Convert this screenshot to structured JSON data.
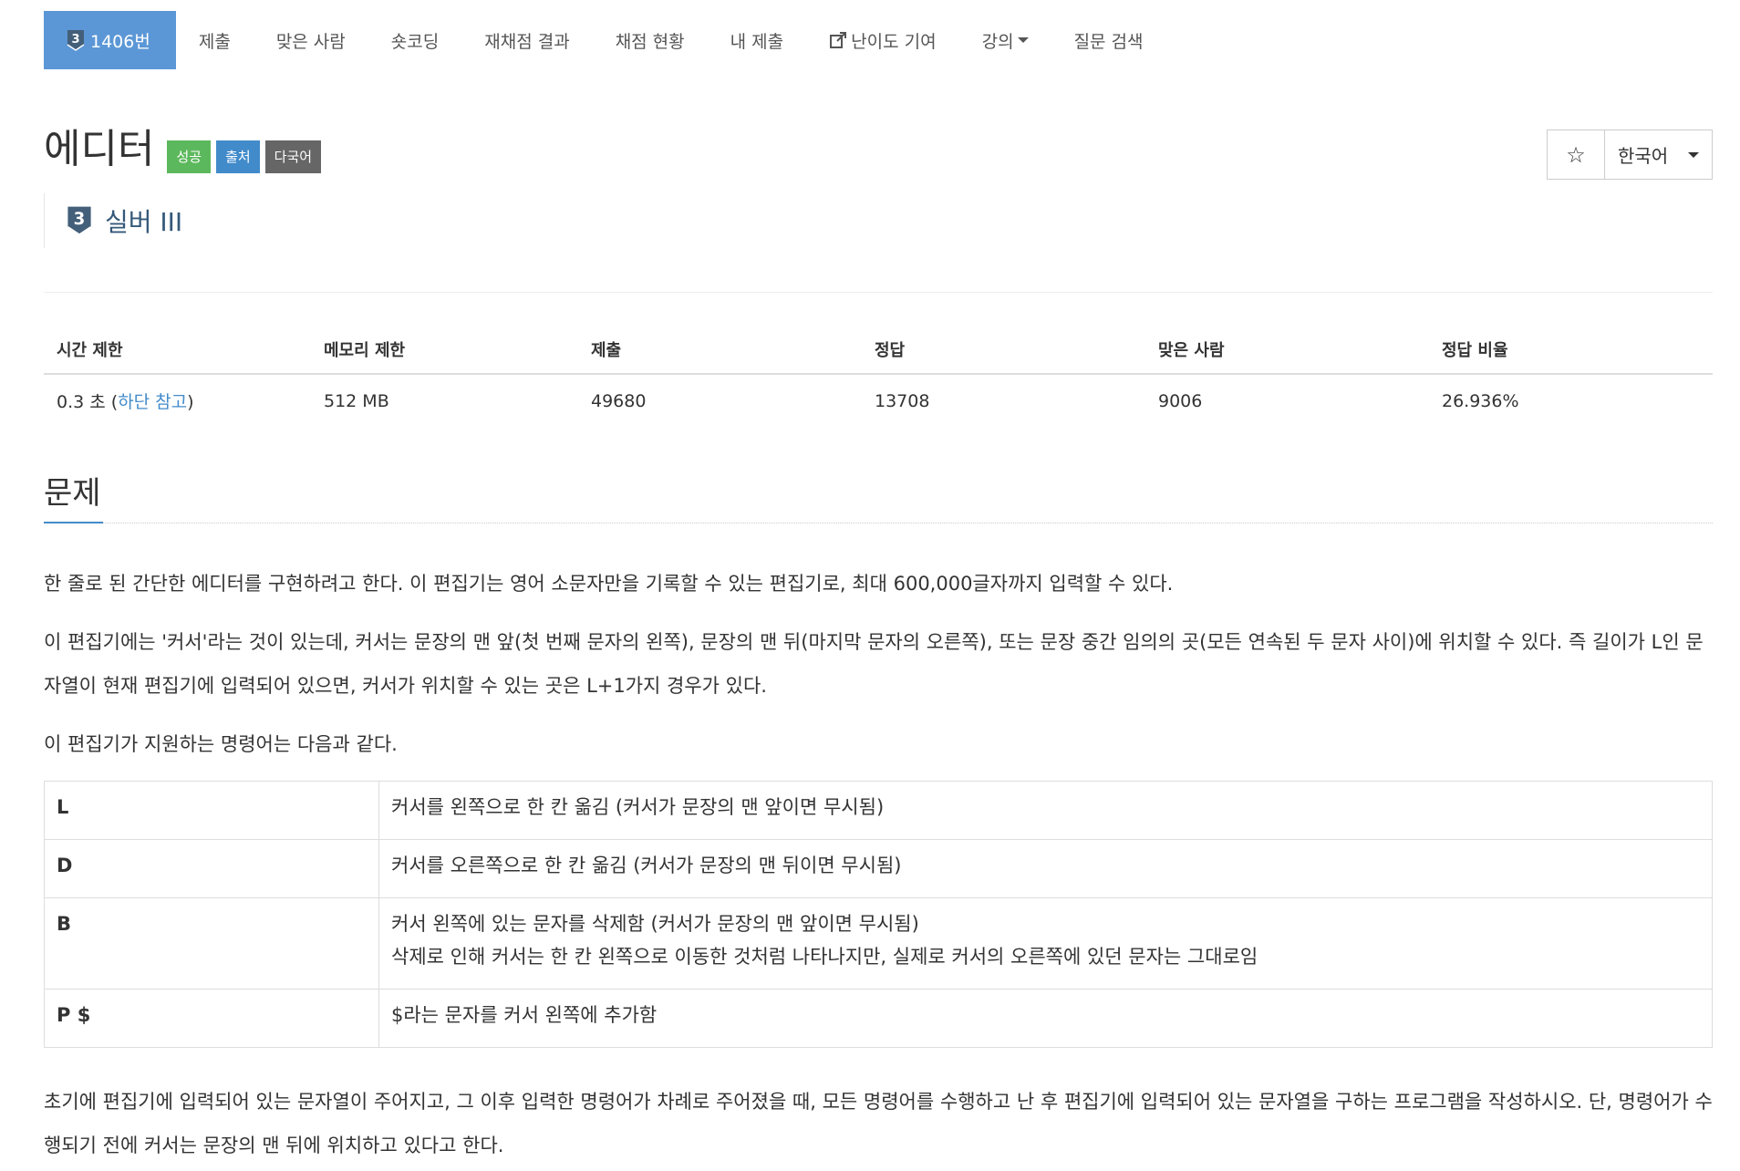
{
  "nav": {
    "problem_number": "1406번",
    "tier_digit": "3",
    "items": [
      {
        "label": "제출"
      },
      {
        "label": "맞은 사람"
      },
      {
        "label": "숏코딩"
      },
      {
        "label": "재채점 결과"
      },
      {
        "label": "채점 현황"
      },
      {
        "label": "내 제출"
      },
      {
        "label": "난이도 기여"
      },
      {
        "label": "강의"
      },
      {
        "label": "질문 검색"
      }
    ]
  },
  "problem": {
    "title": "에디터",
    "labels": [
      "성공",
      "출처",
      "다국어"
    ],
    "tier_digit": "3",
    "tier_name": "실버 III"
  },
  "toolbar": {
    "star_glyph": "☆",
    "language": "한국어"
  },
  "info_table": {
    "headers": [
      "시간 제한",
      "메모리 제한",
      "제출",
      "정답",
      "맞은 사람",
      "정답 비율"
    ],
    "time_limit_prefix": "0.3 초 (",
    "time_limit_link": "하단 참고",
    "time_limit_suffix": ")",
    "memory_limit": "512 MB",
    "submissions": "49680",
    "accepted": "13708",
    "solved_users": "9006",
    "ratio": "26.936%"
  },
  "section": {
    "heading": "문제",
    "paragraphs": [
      "한 줄로 된 간단한 에디터를 구현하려고 한다. 이 편집기는 영어 소문자만을 기록할 수 있는 편집기로, 최대 600,000글자까지 입력할 수 있다.",
      "이 편집기에는 '커서'라는 것이 있는데, 커서는 문장의 맨 앞(첫 번째 문자의 왼쪽), 문장의 맨 뒤(마지막 문자의 오른쪽), 또는 문장 중간 임의의 곳(모든 연속된 두 문자 사이)에 위치할 수 있다. 즉 길이가 L인 문자열이 현재 편집기에 입력되어 있으면, 커서가 위치할 수 있는 곳은 L+1가지 경우가 있다.",
      "이 편집기가 지원하는 명령어는 다음과 같다."
    ],
    "commands": [
      {
        "key": "L",
        "desc": "커서를 왼쪽으로 한 칸 옮김 (커서가 문장의 맨 앞이면 무시됨)",
        "desc2": ""
      },
      {
        "key": "D",
        "desc": "커서를 오른쪽으로 한 칸 옮김 (커서가 문장의 맨 뒤이면 무시됨)",
        "desc2": ""
      },
      {
        "key": "B",
        "desc": "커서 왼쪽에 있는 문자를 삭제함 (커서가 문장의 맨 앞이면 무시됨)",
        "desc2": "삭제로 인해 커서는 한 칸 왼쪽으로 이동한 것처럼 나타나지만, 실제로 커서의 오른쪽에 있던 문자는 그대로임"
      },
      {
        "key": "P $",
        "desc": "$라는 문자를 커서 왼쪽에 추가함",
        "desc2": ""
      }
    ],
    "closing": "초기에 편집기에 입력되어 있는 문자열이 주어지고, 그 이후 입력한 명령어가 차례로 주어졌을 때, 모든 명령어를 수행하고 난 후 편집기에 입력되어 있는 문자열을 구하는 프로그램을 작성하시오. 단, 명령어가 수행되기 전에 커서는 문장의 맨 뒤에 위치하고 있다고 한다."
  },
  "colors": {
    "nav_active": "#5b97d6",
    "link": "#428bca",
    "label_success": "#5cb85c",
    "label_info": "#428bca",
    "label_default": "#666666",
    "tier_silver": "#435f7a"
  }
}
